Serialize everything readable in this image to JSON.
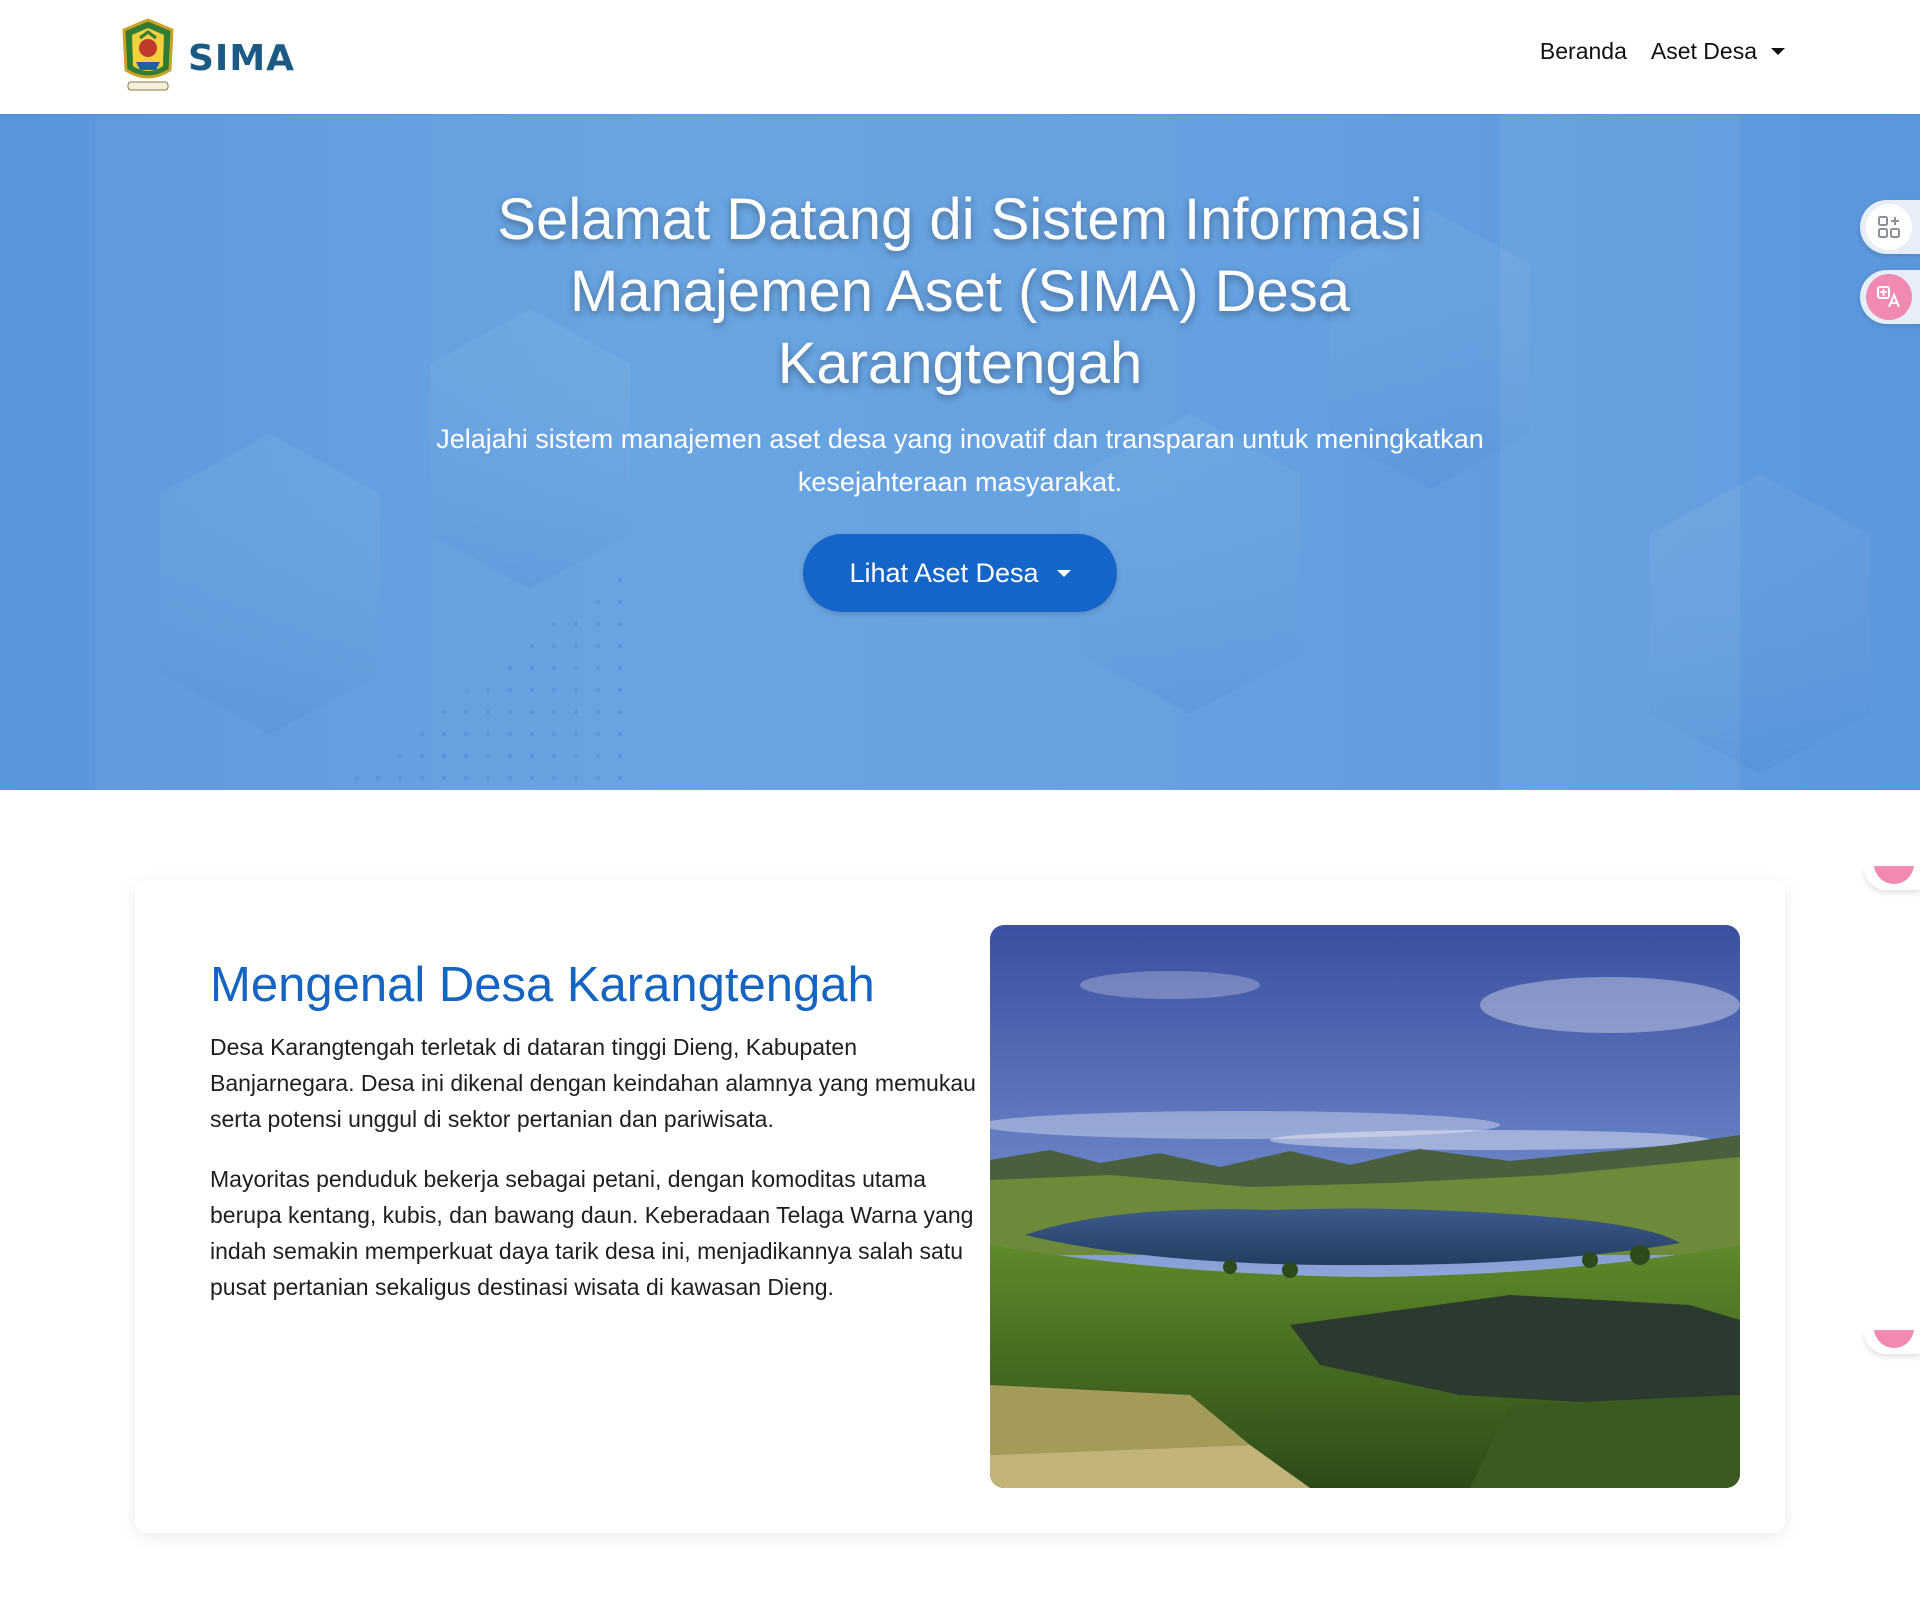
{
  "navbar": {
    "brand": "SIMA",
    "links": [
      {
        "label": "Beranda"
      },
      {
        "label": "Aset Desa"
      }
    ]
  },
  "hero": {
    "title": "Selamat Datang di Sistem Informasi Manajemen Aset (SIMA) Desa Karangtengah",
    "subtitle": "Jelajahi sistem manajemen aset desa yang inovatif dan transparan untuk meningkatkan kesejahteraan masyarakat.",
    "button_label": "Lihat Aset Desa"
  },
  "about": {
    "title": "Mengenal Desa Karangtengah",
    "paragraphs": [
      "Desa Karangtengah terletak di dataran tinggi Dieng, Kabupaten Banjarnegara. Desa ini dikenal dengan keindahan alamnya yang memukau serta potensi unggul di sektor pertanian dan pariwisata.",
      "Mayoritas penduduk bekerja sebagai petani, dengan komoditas utama berupa kentang, kubis, dan bawang daun. Keberadaan Telaga Warna yang indah semakin memperkuat daya tarik desa ini, menjadikannya salah satu pusat pertanian sekaligus destinasi wisata di kawasan Dieng."
    ]
  },
  "icons": {
    "logo": "regency-emblem-icon",
    "nav_dropdown": "caret-down-icon",
    "apps_widget": "apps-grid-icon",
    "translate_widget": "translate-icon"
  },
  "colors": {
    "brand_text": "#1b5a83",
    "hero_bg": "#65a0e0",
    "primary_button": "#1565c8",
    "about_title": "#1565c0",
    "translate_accent": "#f08ab2"
  }
}
